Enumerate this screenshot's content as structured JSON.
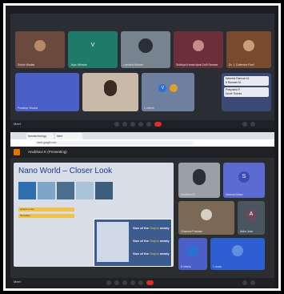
{
  "top_call": {
    "participants": [
      {
        "name": "Sohini Modak",
        "initial": "",
        "bg": "#6b4a3d"
      },
      {
        "name": "Jaya Vithalan",
        "initial": "V",
        "bg": "#1f7a6a"
      },
      {
        "name": "Lancelot Mohan",
        "initial": "",
        "bg": "#77848f"
      },
      {
        "name": "Siddiqui Kamal Iqbal Zulfi Sanwar",
        "initial": "",
        "bg": "#6b2f3a"
      },
      {
        "name": "Dr. J. Dulendra Rani",
        "initial": "",
        "bg": "#7a4a2f"
      },
      {
        "name": "Pradeep Shukla",
        "initial": "",
        "bg": "#4a5fc7"
      },
      {
        "name": "",
        "initial": "",
        "bg": "#c9b9a8"
      },
      {
        "name": "1 others",
        "initial": "V",
        "bg": "#6f7fa0"
      }
    ],
    "chat": [
      {
        "sender": "Nabeela Ramzan M.",
        "text": "6 Ramzan M."
      },
      {
        "sender": "Pratyusha P.",
        "text": "Uncle Thanks"
      }
    ],
    "bar_label": "Meet"
  },
  "browser": {
    "tabs": [
      "Nanotechnology",
      "Meet"
    ],
    "url": "meet.google.com",
    "meeting_title": "Anubhavi K (Presenting)"
  },
  "slide": {
    "title": "Nano World – Closer Look",
    "notes": [
      "Quantum dot",
      "Nanofiber"
    ],
    "popup_lines": [
      {
        "pre": "Size of the",
        "hl": "Object",
        "post": "nearly"
      },
      {
        "pre": "Size of the",
        "hl": "Object",
        "post": "nearly"
      },
      {
        "pre": "Size of the",
        "hl": "Object",
        "post": "nearly"
      }
    ]
  },
  "side_tiles": [
    {
      "name": "Anubhavi K",
      "initial": "",
      "bg": "#9aa0a6"
    },
    {
      "name": "Samuel Alban",
      "initial": "S",
      "bg": "#5b6bd1"
    },
    {
      "name": "Chandra Prakash",
      "initial": "",
      "bg": "#7a6a55"
    },
    {
      "name": "Aldin Jose",
      "initial": "A",
      "bg": "#4a5560"
    },
    {
      "name": "6 others",
      "initial": "",
      "bg": "#4a5fc7"
    },
    {
      "name": "1 more",
      "initial": "",
      "bg": "#2d5fd2"
    }
  ],
  "bottom_bar_label": "Meet"
}
